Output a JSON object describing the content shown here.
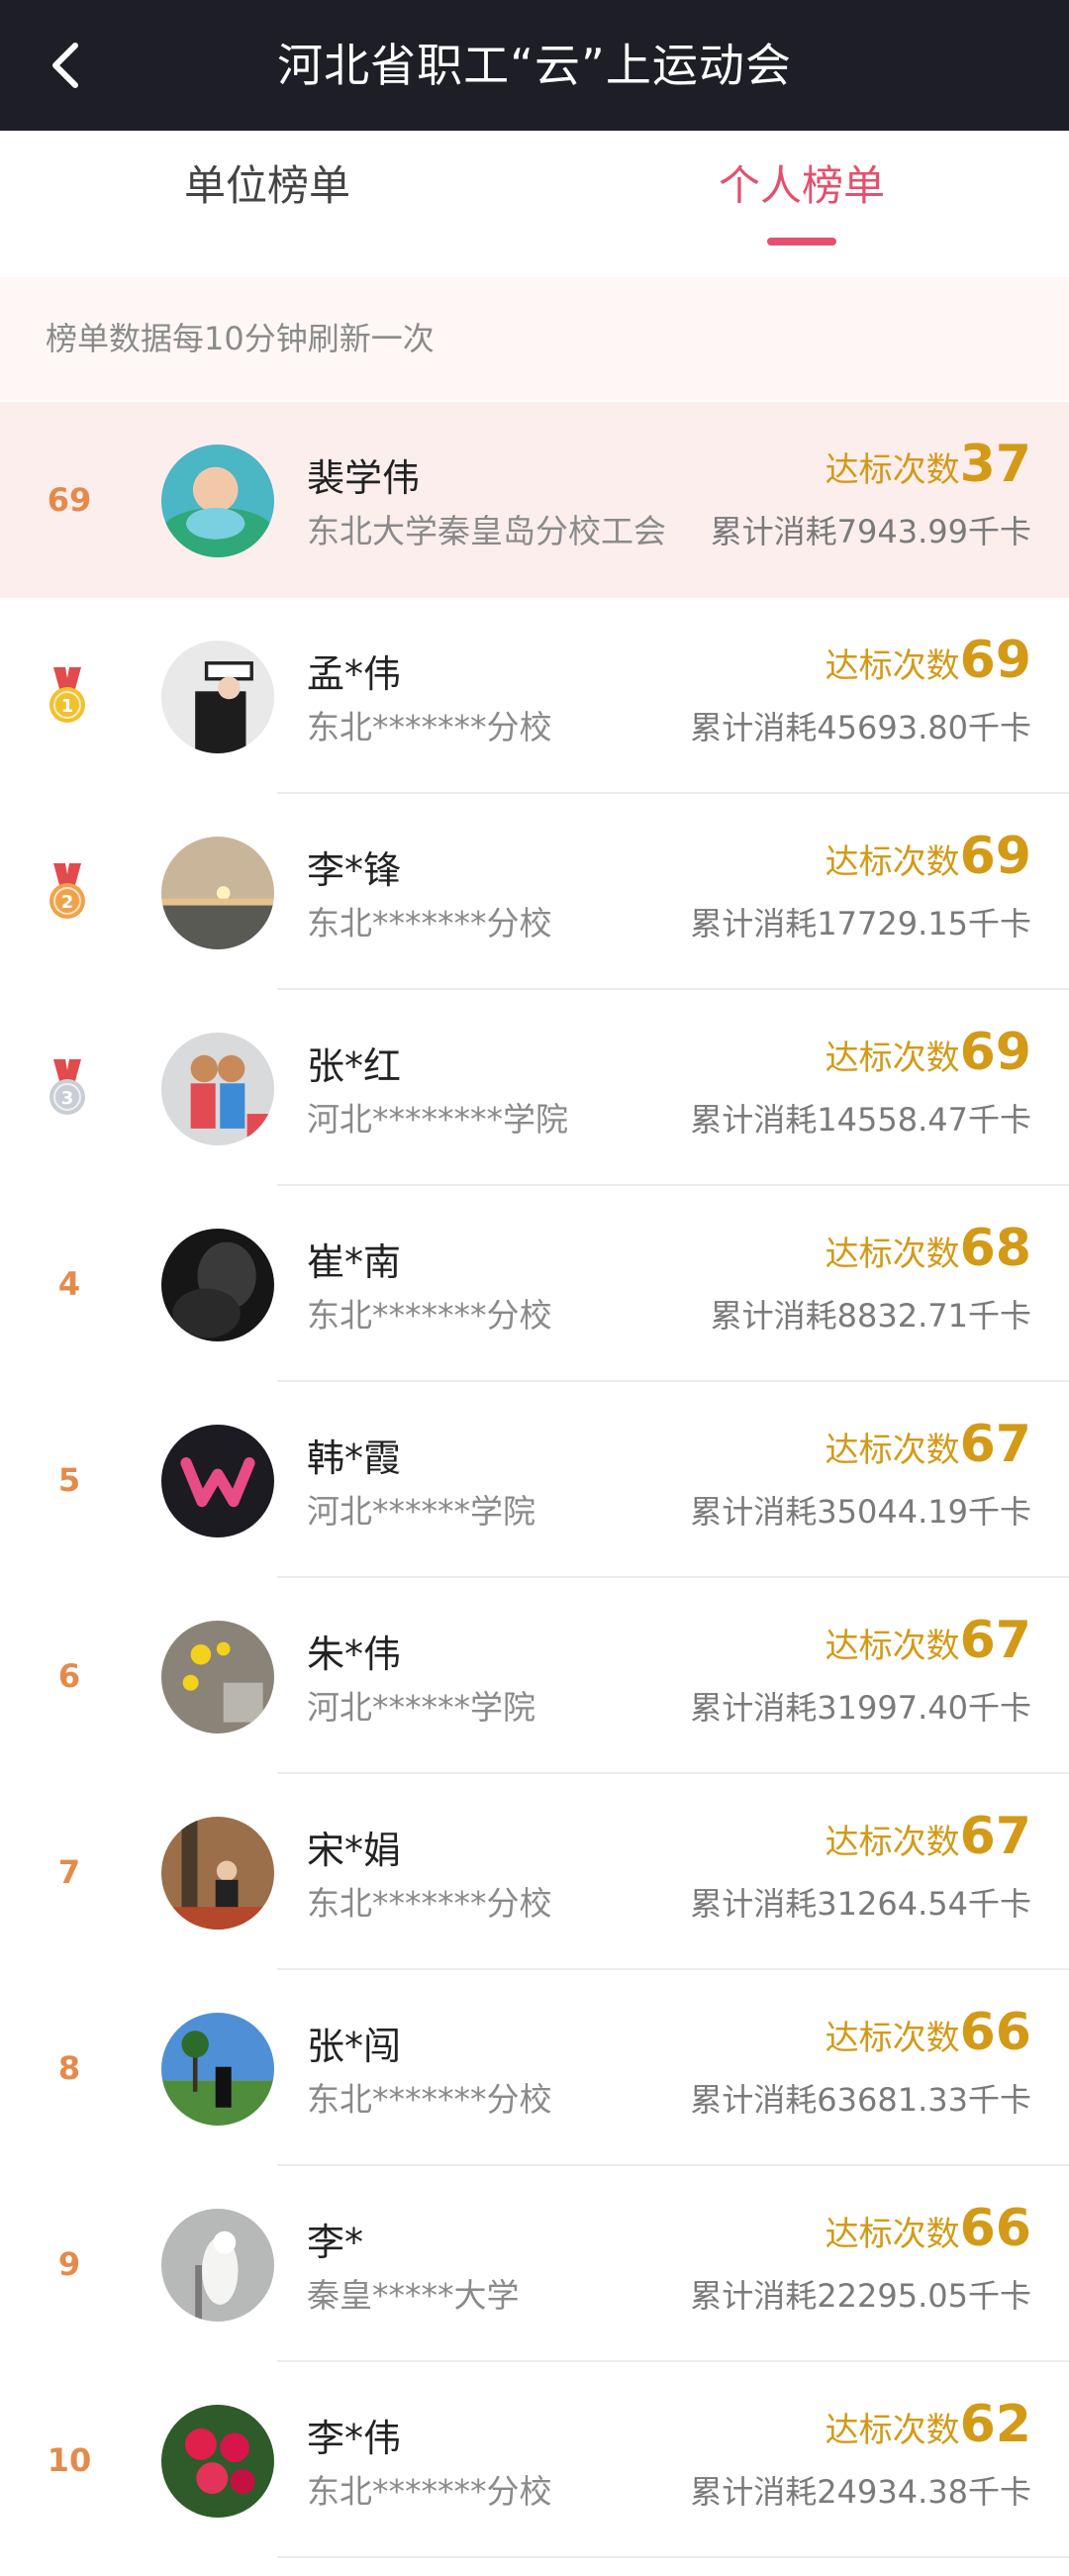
{
  "header": {
    "title": "河北省职工“云”上运动会"
  },
  "tabs": [
    {
      "label": "单位榜单",
      "active": false
    },
    {
      "label": "个人榜单",
      "active": true
    }
  ],
  "notice": "榜单数据每10分钟刷新一次",
  "colors": {
    "accent": "#e4506e",
    "gold": "#d39a18",
    "rank": "#e58a4a"
  },
  "me": {
    "rank": "69",
    "name": "裴学伟",
    "org": "东北大学秦皇岛分校工会",
    "count_label": "达标次数",
    "count": "37",
    "calories": "累计消耗7943.99千卡",
    "avatar": "baby-in-pool"
  },
  "rows": [
    {
      "rank": "1",
      "medal": "gold",
      "name": "孟*伟",
      "org": "东北*******分校",
      "count_label": "达标次数",
      "count": "69",
      "calories": "累计消耗45693.80千卡",
      "avatar": "naval-officer"
    },
    {
      "rank": "2",
      "medal": "silver-red",
      "name": "李*锋",
      "org": "东北*******分校",
      "count_label": "达标次数",
      "count": "69",
      "calories": "累计消耗17729.15千卡",
      "avatar": "sunset"
    },
    {
      "rank": "3",
      "medal": "silver",
      "name": "张*红",
      "org": "河北********学院",
      "count_label": "达标次数",
      "count": "69",
      "calories": "累计消耗14558.47千卡",
      "avatar": "kids-kiss"
    },
    {
      "rank": "4",
      "medal": "",
      "name": "崔*南",
      "org": "东北*******分校",
      "count_label": "达标次数",
      "count": "68",
      "calories": "累计消耗8832.71千卡",
      "avatar": "dark-portrait"
    },
    {
      "rank": "5",
      "medal": "",
      "name": "韩*霞",
      "org": "河北******学院",
      "count_label": "达标次数",
      "count": "67",
      "calories": "累计消耗35044.19千卡",
      "avatar": "w-logo"
    },
    {
      "rank": "6",
      "medal": "",
      "name": "朱*伟",
      "org": "河北******学院",
      "count_label": "达标次数",
      "count": "67",
      "calories": "累计消耗31997.40千卡",
      "avatar": "yellow-flowers"
    },
    {
      "rank": "7",
      "medal": "",
      "name": "宋*娟",
      "org": "东北*******分校",
      "count_label": "达标次数",
      "count": "67",
      "calories": "累计消耗31264.54千卡",
      "avatar": "autumn-woman"
    },
    {
      "rank": "8",
      "medal": "",
      "name": "张*闯",
      "org": "东北*******分校",
      "count_label": "达标次数",
      "count": "66",
      "calories": "累计消耗63681.33千卡",
      "avatar": "palm-beach"
    },
    {
      "rank": "9",
      "medal": "",
      "name": "李*",
      "org": "秦皇*****大学",
      "count_label": "达标次数",
      "count": "66",
      "calories": "累计消耗22295.05千卡",
      "avatar": "cockatoo"
    },
    {
      "rank": "10",
      "medal": "",
      "name": "李*伟",
      "org": "东北*******分校",
      "count_label": "达标次数",
      "count": "62",
      "calories": "累计消耗24934.38千卡",
      "avatar": "red-roses"
    }
  ]
}
